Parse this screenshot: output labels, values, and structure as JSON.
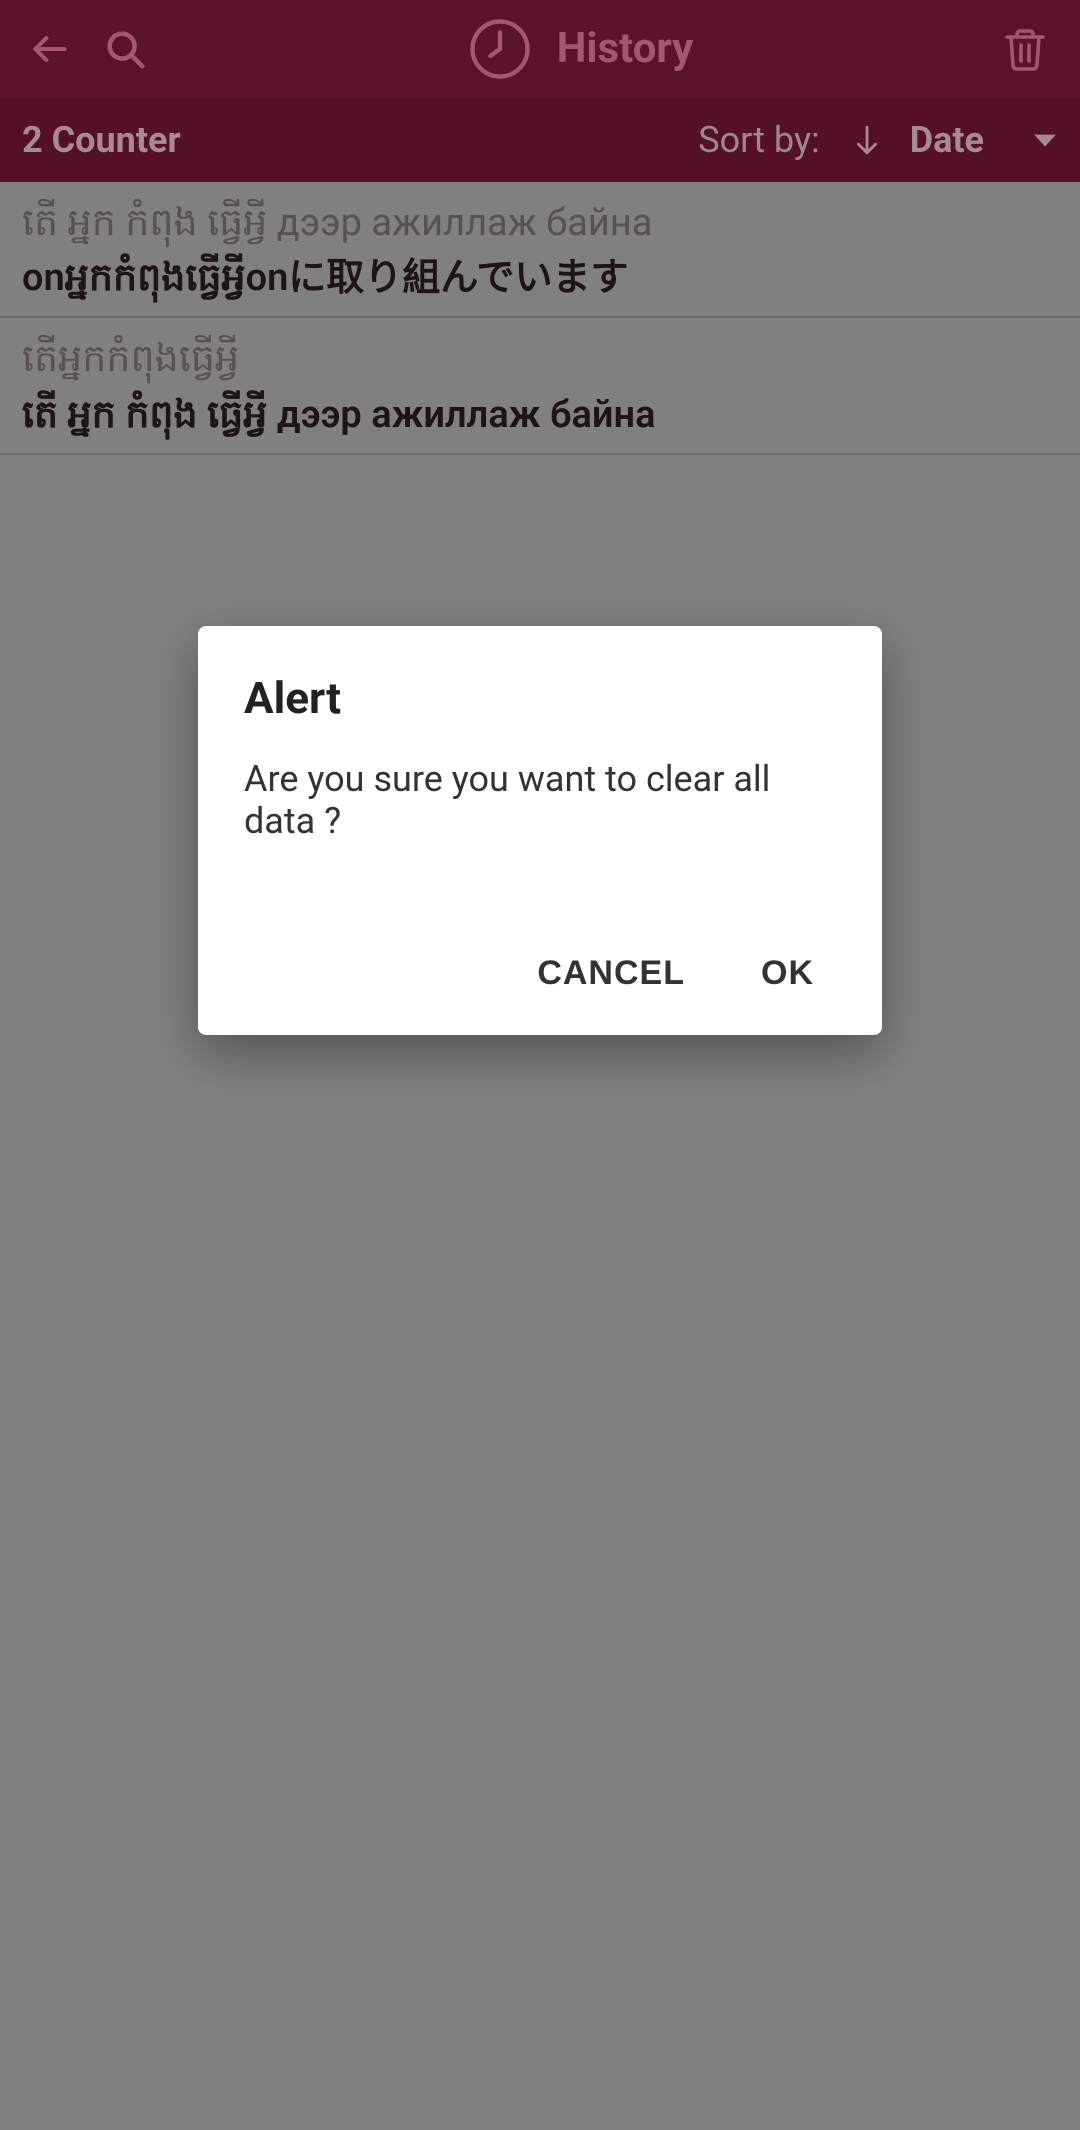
{
  "header": {
    "title": "History"
  },
  "subheader": {
    "counter": "2 Counter",
    "sort_by_label": "Sort by:",
    "sort_value": "Date"
  },
  "history": {
    "items": [
      {
        "source": "តើ អ្នក កំពុង ធ្វើអ្វី дээр ажиллаж байна",
        "result": "onអ្នកកំពុងធ្វើអ្វីonに取り組んでいます"
      },
      {
        "source": "តើអ្នកកំពុងធ្វើអ្វី",
        "result": "តើ អ្នក កំពុង ធ្វើអ្វី дээр ажиллаж байна"
      }
    ]
  },
  "dialog": {
    "title": "Alert",
    "message": "Are you sure you want to clear all data ?",
    "cancel": "CANCEL",
    "ok": "OK"
  }
}
